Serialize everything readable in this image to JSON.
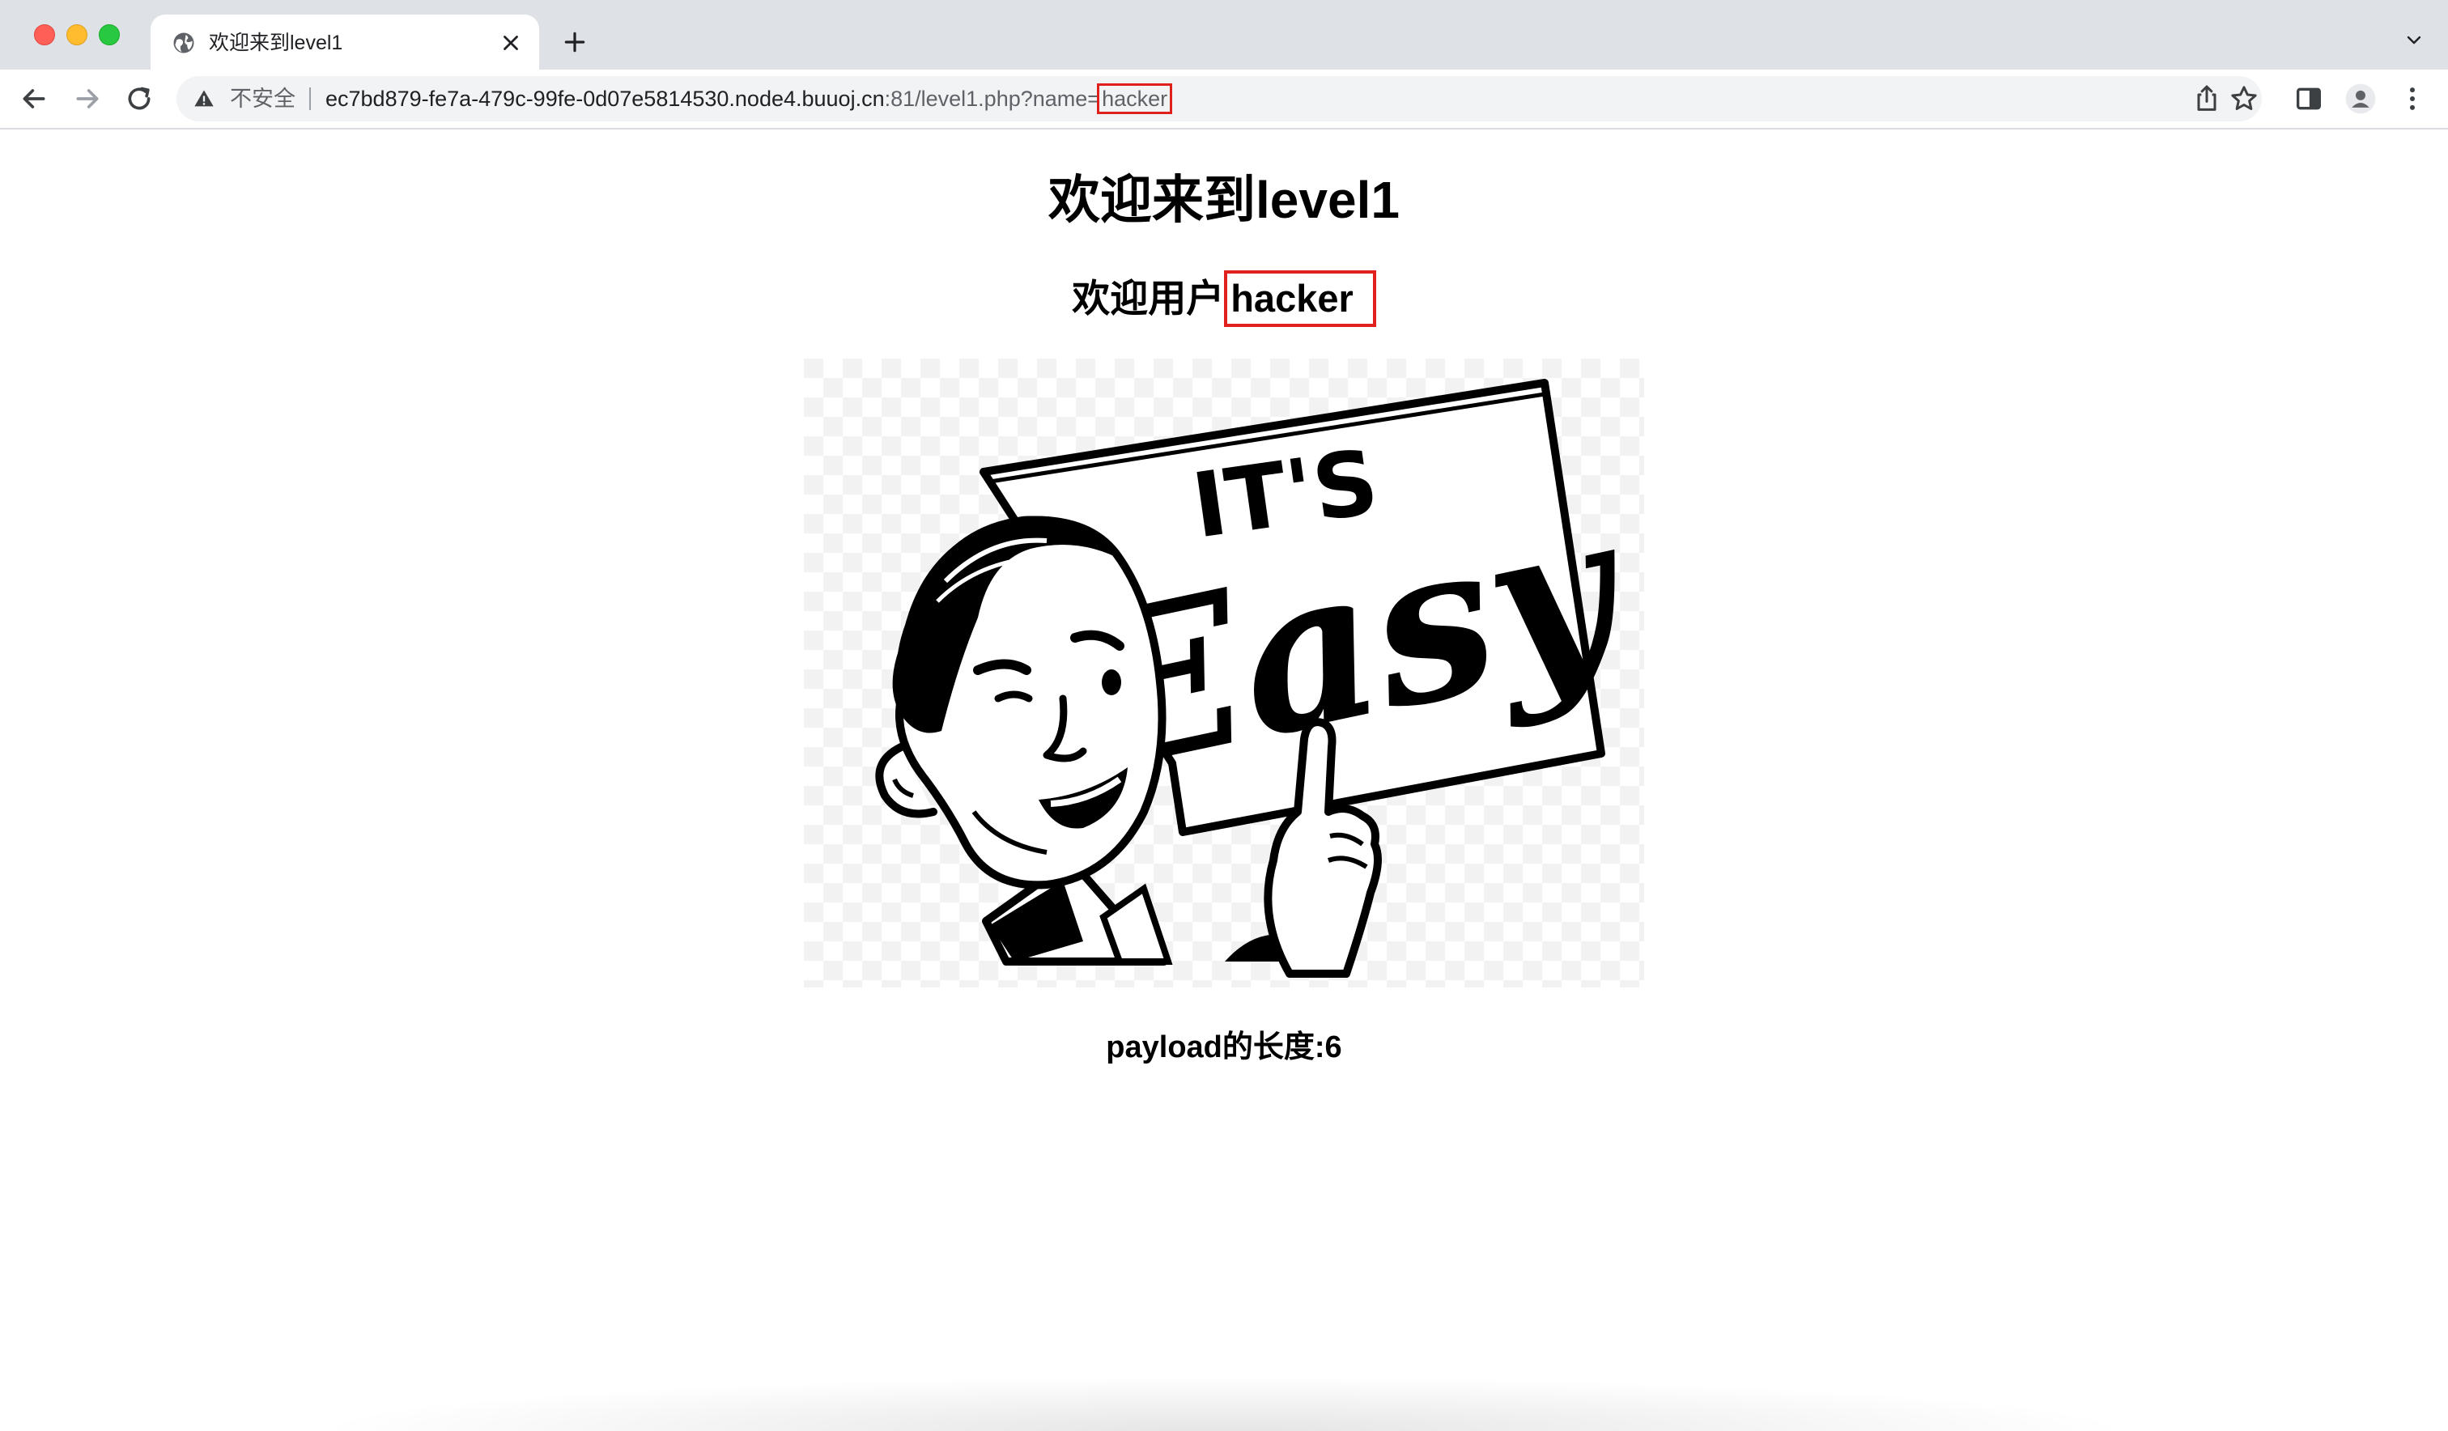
{
  "browser": {
    "tab": {
      "title": "欢迎来到level1"
    },
    "omnibox": {
      "security_label": "不安全",
      "url_host": "ec7bd879-fe7a-479c-99fe-0d07e5814530.node4.buuoj.cn",
      "url_path": ":81/level1.php?name=",
      "url_param_value": "hacker"
    }
  },
  "page": {
    "title": "欢迎来到level1",
    "welcome_prefix": "欢迎用户",
    "username": "hacker",
    "image": {
      "sign_line1": "IT'S",
      "sign_line2": "Easy"
    },
    "payload_length": "payload的长度:6"
  },
  "colors": {
    "highlight_box": "#e0201c",
    "tabstrip_bg": "#dee1e6",
    "omnibox_bg": "#f1f3f4"
  }
}
